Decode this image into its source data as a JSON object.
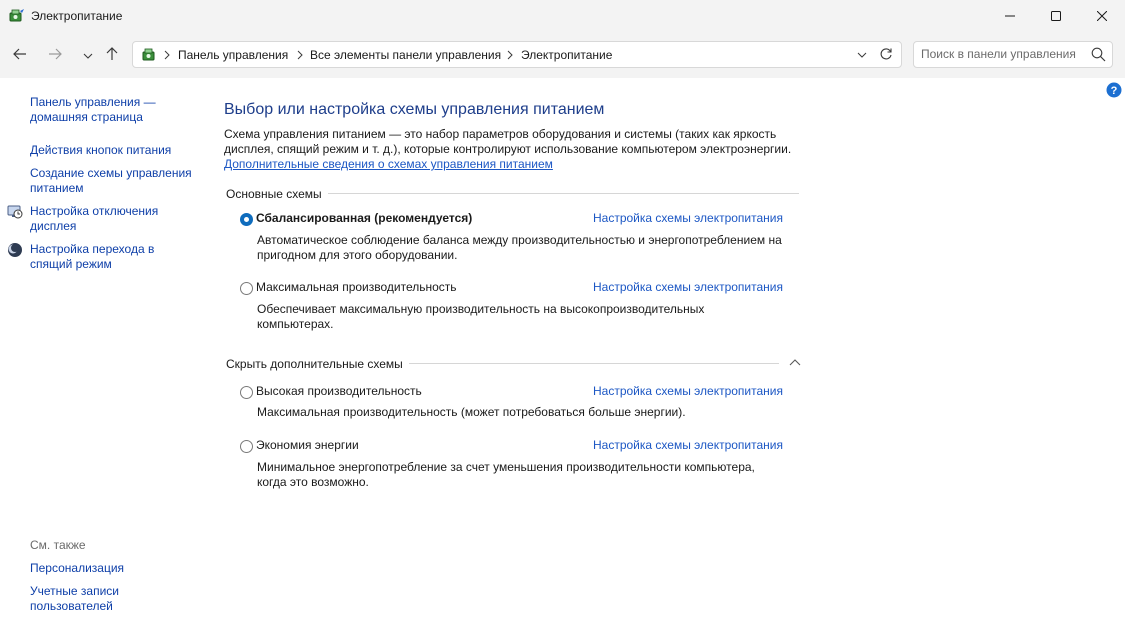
{
  "window": {
    "title": "Электропитание",
    "app_icon": "power-options-icon",
    "minimize_icon": "minimize-icon",
    "maximize_icon": "maximize-icon",
    "close_icon": "close-icon"
  },
  "nav": {
    "back_icon": "back-arrow-icon",
    "forward_icon": "forward-arrow-icon",
    "recent_icon": "chevron-down-icon",
    "up_icon": "up-arrow-icon",
    "breadcrumbs": [
      "Панель управления",
      "Все элементы панели управления",
      "Электропитание"
    ],
    "search_placeholder": "Поиск в панели управления"
  },
  "sidebar": {
    "home_link": "Панель управления — домашняя страница",
    "items": [
      {
        "label": "Действия кнопок питания"
      },
      {
        "label": "Создание схемы управления питанием"
      },
      {
        "label": "Настройка отключения дисплея",
        "icon": "display-clock-icon"
      },
      {
        "label": "Настройка перехода в спящий режим",
        "icon": "moon-icon"
      }
    ],
    "see_also": "См. также",
    "see_also_items": [
      {
        "label": "Персонализация"
      },
      {
        "label": "Учетные записи пользователей"
      }
    ]
  },
  "main": {
    "title": "Выбор или настройка схемы управления питанием",
    "description": "Схема управления питанием — это набор параметров оборудования и системы (таких как яркость дисплея, спящий режим и т. д.), которые контролируют использование компьютером электроэнергии.",
    "more_link": "Дополнительные сведения о схемах управления питанием",
    "group_main": "Основные схемы",
    "group_extra": "Скрыть дополнительные схемы",
    "plans": [
      {
        "name": "Сбалансированная (рекомендуется)",
        "selected": true,
        "link": "Настройка схемы электропитания",
        "description": "Автоматическое соблюдение баланса между производительностью и энергопотреблением на пригодном для этого оборудовании."
      },
      {
        "name": "Максимальная производительность",
        "selected": false,
        "link": "Настройка схемы электропитания",
        "description": "Обеспечивает максимальную производительность на высокопроизводительных компьютерах."
      },
      {
        "name": "Высокая производительность",
        "selected": false,
        "link": "Настройка схемы электропитания",
        "description": "Максимальная производительность (может потребоваться больше энергии)."
      },
      {
        "name": "Экономия энергии",
        "selected": false,
        "link": "Настройка схемы электропитания",
        "description": "Минимальное энергопотребление за счет уменьшения производительности компьютера, когда это возможно."
      }
    ]
  },
  "colors": {
    "title_blue": "#1e3e8b",
    "link_blue": "#1c57c4",
    "radio_selected": "#0f6cbd"
  }
}
